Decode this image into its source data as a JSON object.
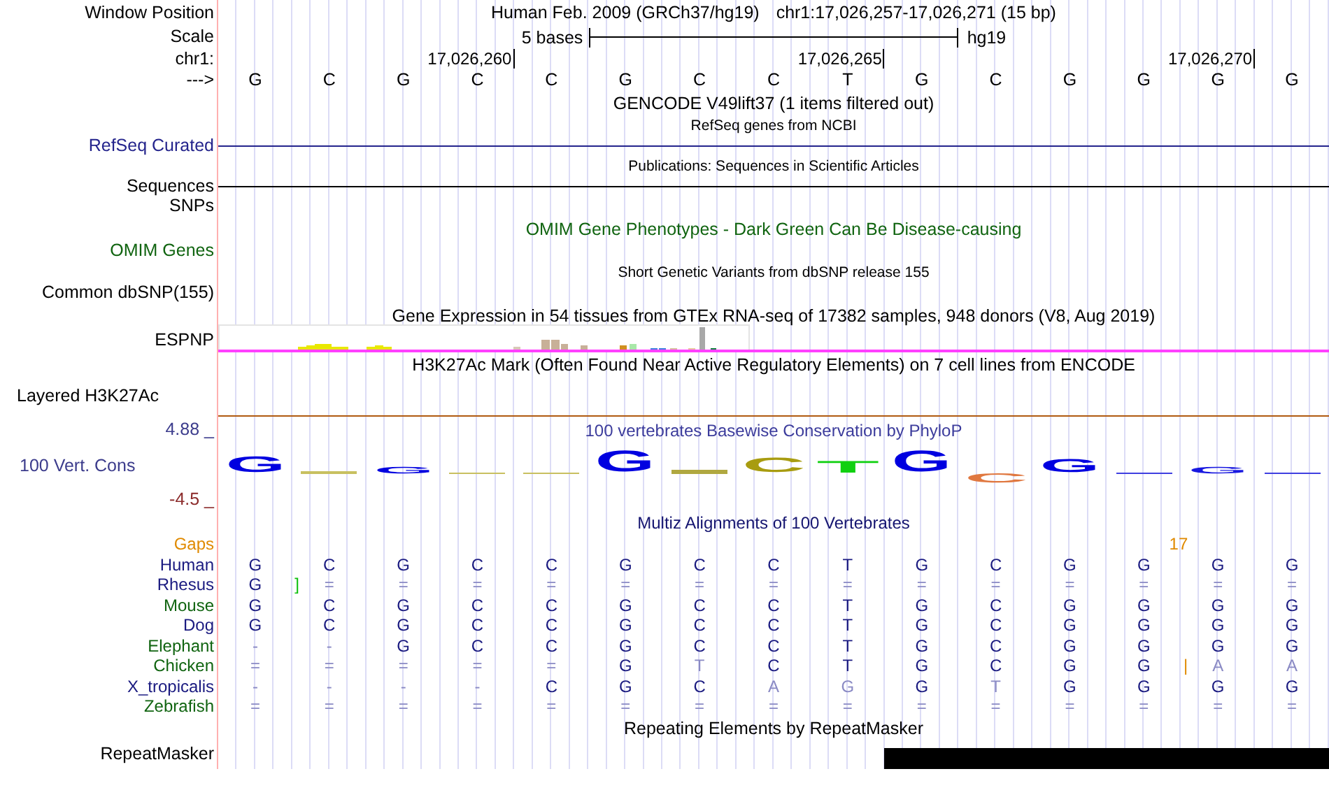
{
  "header": {
    "label": "Window Position",
    "title": "Human Feb. 2009 (GRCh37/hg19)",
    "position": "chr1:17,026,257-17,026,271 (15 bp)"
  },
  "scale": {
    "label": "Scale",
    "span": "5 bases",
    "assembly": "hg19"
  },
  "ruler": {
    "label": "chr1:",
    "ticks": [
      "17,026,260",
      "17,026,265",
      "17,026,270"
    ]
  },
  "sequence": {
    "label": "--->",
    "bases": [
      "G",
      "C",
      "G",
      "C",
      "C",
      "G",
      "C",
      "C",
      "T",
      "G",
      "C",
      "G",
      "G",
      "G",
      "G"
    ]
  },
  "tracks": [
    {
      "kind": "title",
      "title": "GENCODE V49lift37 (1 items filtered out)"
    },
    {
      "kind": "note",
      "title": "RefSeq genes from NCBI"
    },
    {
      "kind": "line",
      "label": "RefSeq Curated",
      "color": "#24248c"
    },
    {
      "kind": "note",
      "title": "Publications: Sequences in Scientific Articles"
    },
    {
      "kind": "line",
      "label": "Sequences",
      "color": "#000000"
    },
    {
      "kind": "label",
      "label": "SNPs"
    },
    {
      "kind": "title",
      "title": "OMIM Gene Phenotypes - Dark Green Can Be Disease-causing",
      "color": "#106410"
    },
    {
      "kind": "label",
      "label": "OMIM Genes",
      "color": "#106410"
    },
    {
      "kind": "note",
      "title": "Short Genetic Variants from dbSNP release 155"
    },
    {
      "kind": "label",
      "label": "Common dbSNP(155)"
    },
    {
      "kind": "title",
      "title": "Gene Expression in 54 tissues from GTEx RNA-seq of 17382 samples, 948 donors (V8, Aug 2019)"
    },
    {
      "kind": "expression",
      "label": "ESPNP"
    },
    {
      "kind": "title",
      "title": "H3K27Ac Mark (Often Found Near Active Regulatory Elements) on 7 cell lines from ENCODE"
    },
    {
      "kind": "layered",
      "label": "Layered H3K27Ac"
    }
  ],
  "conservation": {
    "label": "100 Vert. Cons",
    "title": "100 vertebrates Basewise Conservation by PhyloP",
    "ymax": "4.88 _",
    "ymin": "-4.5 _",
    "columns": [
      {
        "kind": "letter",
        "letter": "G",
        "color": "#0000e0"
      },
      {
        "kind": "sliver",
        "color": "#c8c060"
      },
      {
        "kind": "letter",
        "letter": "G",
        "color": "#0000e0"
      },
      {
        "kind": "sliver",
        "color": "#c8c060"
      },
      {
        "kind": "sliver",
        "color": "#c8c060"
      },
      {
        "kind": "letter",
        "letter": "G",
        "color": "#0000e0"
      },
      {
        "kind": "sliver",
        "color": "#b0a840"
      },
      {
        "kind": "letter",
        "letter": "C",
        "color": "#a89c10"
      },
      {
        "kind": "letter",
        "letter": "T",
        "color": "#10d010"
      },
      {
        "kind": "letter",
        "letter": "G",
        "color": "#0000e0"
      },
      {
        "kind": "letter-below",
        "letter": "C",
        "color": "#e07840"
      },
      {
        "kind": "letter",
        "letter": "G",
        "color": "#0000e0"
      },
      {
        "kind": "sliver",
        "color": "#4040e0"
      },
      {
        "kind": "letter",
        "letter": "G",
        "color": "#1818e0"
      },
      {
        "kind": "sliver",
        "color": "#4040e0"
      }
    ]
  },
  "alignment": {
    "title": "Multiz Alignments of 100 Vertebrates",
    "gaps": {
      "label": "Gaps",
      "color": "#e08a00",
      "insertions": [
        {
          "text": "17",
          "color": "#e08a00"
        }
      ]
    },
    "species": [
      {
        "name": "Human",
        "color": "#1a1a80",
        "cells": [
          {
            "text": "G",
            "faded": false
          },
          {
            "text": "C",
            "faded": false
          },
          {
            "text": "G",
            "faded": false
          },
          {
            "text": "C",
            "faded": false
          },
          {
            "text": "C",
            "faded": false
          },
          {
            "text": "G",
            "faded": false
          },
          {
            "text": "C",
            "faded": false
          },
          {
            "text": "C",
            "faded": false
          },
          {
            "text": "T",
            "faded": false
          },
          {
            "text": "G",
            "faded": false
          },
          {
            "text": "C",
            "faded": false
          },
          {
            "text": "G",
            "faded": false
          },
          {
            "text": "G",
            "faded": false
          },
          {
            "text": "G",
            "faded": false
          },
          {
            "text": "G",
            "faded": false
          }
        ]
      },
      {
        "name": "Rhesus",
        "color": "#1a1a80",
        "cells": [
          {
            "text": "G",
            "faded": false,
            "insertion": {
              "text": "]",
              "color": "#10c010"
            }
          },
          {
            "text": "=",
            "faded": true
          },
          {
            "text": "=",
            "faded": true
          },
          {
            "text": "=",
            "faded": true
          },
          {
            "text": "=",
            "faded": true
          },
          {
            "text": "=",
            "faded": true
          },
          {
            "text": "=",
            "faded": true
          },
          {
            "text": "=",
            "faded": true
          },
          {
            "text": "=",
            "faded": true
          },
          {
            "text": "=",
            "faded": true
          },
          {
            "text": "=",
            "faded": true
          },
          {
            "text": "=",
            "faded": true
          },
          {
            "text": "=",
            "faded": true
          },
          {
            "text": "=",
            "faded": true
          },
          {
            "text": "=",
            "faded": true
          }
        ]
      },
      {
        "name": "Mouse",
        "color": "#106410",
        "cells": [
          {
            "text": "G",
            "faded": false
          },
          {
            "text": "C",
            "faded": false
          },
          {
            "text": "G",
            "faded": false
          },
          {
            "text": "C",
            "faded": false
          },
          {
            "text": "C",
            "faded": false
          },
          {
            "text": "G",
            "faded": false
          },
          {
            "text": "C",
            "faded": false
          },
          {
            "text": "C",
            "faded": false
          },
          {
            "text": "T",
            "faded": false
          },
          {
            "text": "G",
            "faded": false
          },
          {
            "text": "C",
            "faded": false
          },
          {
            "text": "G",
            "faded": false
          },
          {
            "text": "G",
            "faded": false
          },
          {
            "text": "G",
            "faded": false
          },
          {
            "text": "G",
            "faded": false
          }
        ]
      },
      {
        "name": "Dog",
        "color": "#1a1a80",
        "cells": [
          {
            "text": "G",
            "faded": false
          },
          {
            "text": "C",
            "faded": false
          },
          {
            "text": "G",
            "faded": false
          },
          {
            "text": "C",
            "faded": false
          },
          {
            "text": "C",
            "faded": false
          },
          {
            "text": "G",
            "faded": false
          },
          {
            "text": "C",
            "faded": false
          },
          {
            "text": "C",
            "faded": false
          },
          {
            "text": "T",
            "faded": false
          },
          {
            "text": "G",
            "faded": false
          },
          {
            "text": "C",
            "faded": false
          },
          {
            "text": "G",
            "faded": false
          },
          {
            "text": "G",
            "faded": false
          },
          {
            "text": "G",
            "faded": false
          },
          {
            "text": "G",
            "faded": false
          }
        ]
      },
      {
        "name": "Elephant",
        "color": "#106410",
        "cells": [
          {
            "text": "-",
            "faded": true
          },
          {
            "text": "-",
            "faded": true
          },
          {
            "text": "G",
            "faded": false
          },
          {
            "text": "C",
            "faded": false
          },
          {
            "text": "C",
            "faded": false
          },
          {
            "text": "G",
            "faded": false
          },
          {
            "text": "C",
            "faded": false
          },
          {
            "text": "C",
            "faded": false
          },
          {
            "text": "T",
            "faded": false
          },
          {
            "text": "G",
            "faded": false
          },
          {
            "text": "C",
            "faded": false
          },
          {
            "text": "G",
            "faded": false
          },
          {
            "text": "G",
            "faded": false
          },
          {
            "text": "G",
            "faded": false
          },
          {
            "text": "G",
            "faded": false
          }
        ]
      },
      {
        "name": "Chicken",
        "color": "#106410",
        "cells": [
          {
            "text": "=",
            "faded": true
          },
          {
            "text": "=",
            "faded": true
          },
          {
            "text": "=",
            "faded": true
          },
          {
            "text": "=",
            "faded": true
          },
          {
            "text": "=",
            "faded": true
          },
          {
            "text": "G",
            "faded": false
          },
          {
            "text": "T",
            "faded": true
          },
          {
            "text": "C",
            "faded": false
          },
          {
            "text": "T",
            "faded": false
          },
          {
            "text": "G",
            "faded": false
          },
          {
            "text": "C",
            "faded": false
          },
          {
            "text": "G",
            "faded": false
          },
          {
            "text": "G",
            "faded": false,
            "insertion": {
              "text": "|",
              "color": "#e08a00"
            }
          },
          {
            "text": "A",
            "faded": true
          },
          {
            "text": "A",
            "faded": true
          }
        ]
      },
      {
        "name": "X_tropicalis",
        "color": "#1a1a80",
        "cells": [
          {
            "text": "-",
            "faded": true
          },
          {
            "text": "-",
            "faded": true
          },
          {
            "text": "-",
            "faded": true
          },
          {
            "text": "-",
            "faded": true
          },
          {
            "text": "C",
            "faded": false
          },
          {
            "text": "G",
            "faded": false
          },
          {
            "text": "C",
            "faded": false
          },
          {
            "text": "A",
            "faded": true
          },
          {
            "text": "G",
            "faded": true
          },
          {
            "text": "G",
            "faded": false
          },
          {
            "text": "T",
            "faded": true
          },
          {
            "text": "G",
            "faded": false
          },
          {
            "text": "G",
            "faded": false
          },
          {
            "text": "G",
            "faded": false
          },
          {
            "text": "G",
            "faded": false
          }
        ]
      },
      {
        "name": "Zebrafish",
        "color": "#106410",
        "cells": [
          {
            "text": "=",
            "faded": true
          },
          {
            "text": "=",
            "faded": true
          },
          {
            "text": "=",
            "faded": true
          },
          {
            "text": "=",
            "faded": true
          },
          {
            "text": "=",
            "faded": true
          },
          {
            "text": "=",
            "faded": true
          },
          {
            "text": "=",
            "faded": true
          },
          {
            "text": "=",
            "faded": true
          },
          {
            "text": "=",
            "faded": true
          },
          {
            "text": "=",
            "faded": true
          },
          {
            "text": "=",
            "faded": true
          },
          {
            "text": "=",
            "faded": true
          },
          {
            "text": "=",
            "faded": true
          },
          {
            "text": "=",
            "faded": true
          },
          {
            "text": "=",
            "faded": true
          }
        ]
      }
    ]
  },
  "repeats": {
    "title": "Repeating Elements by RepeatMasker",
    "label": "RepeatMasker"
  }
}
